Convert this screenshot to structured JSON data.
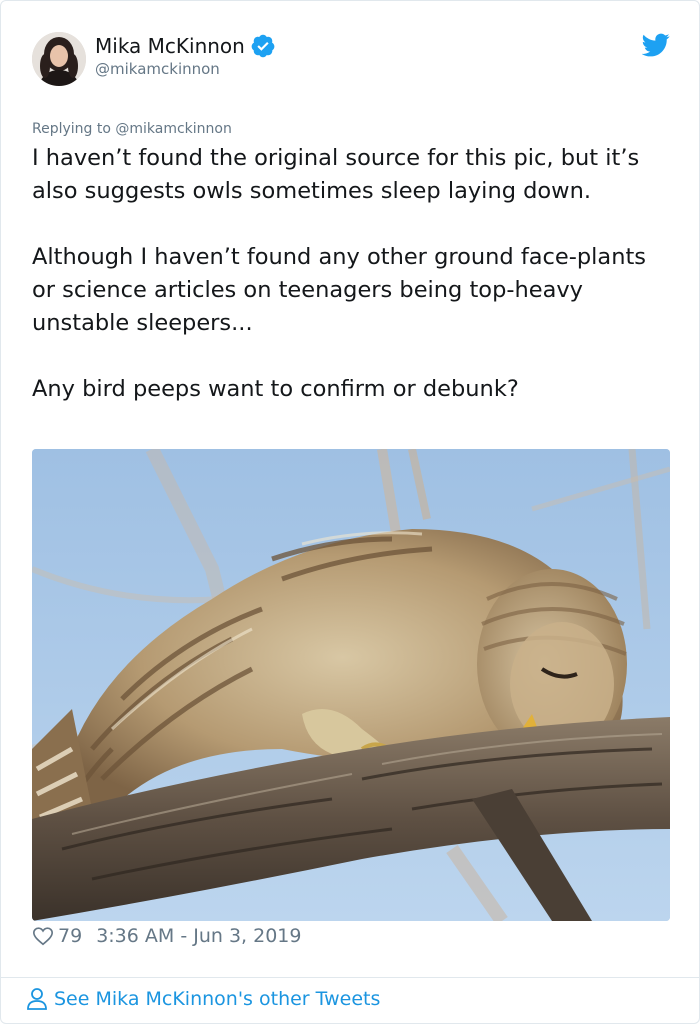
{
  "author": {
    "name": "Mika McKinnon",
    "handle": "@mikamckinnon",
    "avatar_icon": "profile-photo",
    "verified_icon": "verified-badge-icon"
  },
  "reply_context": "Replying to @mikamckinnon",
  "tweet_paragraphs": [
    "I haven’t found the original source for this pic, but it’s also suggests owls sometimes sleep laying down.",
    "Although I haven’t found any other ground face-plants or science articles on teenagers being top-heavy unstable sleepers...",
    "Any bird peeps want to confirm or debunk?"
  ],
  "media": {
    "subject": "photo of an owl sleeping face-down on a tree branch"
  },
  "meta": {
    "likes": "79",
    "timestamp": "3:36 AM - Jun 3, 2019"
  },
  "footer": {
    "link_label": "See Mika McKinnon's other Tweets"
  },
  "colors": {
    "brand": "#1da1f2",
    "link": "#1b95e0",
    "muted": "#657786",
    "text": "#14171a"
  }
}
